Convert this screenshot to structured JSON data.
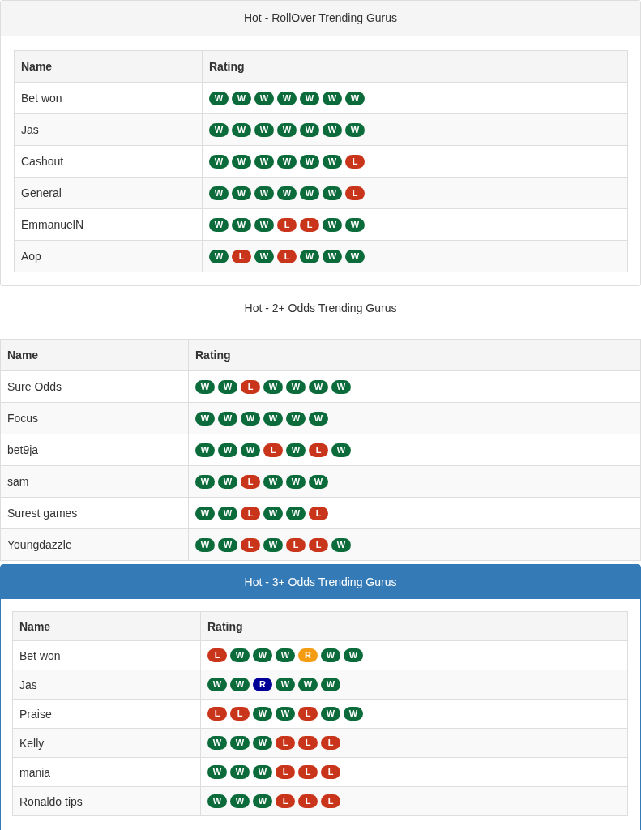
{
  "panels": [
    {
      "kind": "default",
      "title": "Hot - RollOver Trending Gurus",
      "columns": [
        "Name",
        "Rating"
      ],
      "rows": [
        {
          "name": "Bet won",
          "badges": [
            {
              "label": "W",
              "color": "#0b6b3a"
            },
            {
              "label": "W",
              "color": "#0b6b3a"
            },
            {
              "label": "W",
              "color": "#0b6b3a"
            },
            {
              "label": "W",
              "color": "#0b6b3a"
            },
            {
              "label": "W",
              "color": "#0b6b3a"
            },
            {
              "label": "W",
              "color": "#0b6b3a"
            },
            {
              "label": "W",
              "color": "#0b6b3a"
            }
          ]
        },
        {
          "name": "Jas",
          "badges": [
            {
              "label": "W",
              "color": "#0b6b3a"
            },
            {
              "label": "W",
              "color": "#0b6b3a"
            },
            {
              "label": "W",
              "color": "#0b6b3a"
            },
            {
              "label": "W",
              "color": "#0b6b3a"
            },
            {
              "label": "W",
              "color": "#0b6b3a"
            },
            {
              "label": "W",
              "color": "#0b6b3a"
            },
            {
              "label": "W",
              "color": "#0b6b3a"
            }
          ]
        },
        {
          "name": "Cashout",
          "badges": [
            {
              "label": "W",
              "color": "#0b6b3a"
            },
            {
              "label": "W",
              "color": "#0b6b3a"
            },
            {
              "label": "W",
              "color": "#0b6b3a"
            },
            {
              "label": "W",
              "color": "#0b6b3a"
            },
            {
              "label": "W",
              "color": "#0b6b3a"
            },
            {
              "label": "W",
              "color": "#0b6b3a"
            },
            {
              "label": "L",
              "color": "#c9351a"
            }
          ]
        },
        {
          "name": "General",
          "badges": [
            {
              "label": "W",
              "color": "#0b6b3a"
            },
            {
              "label": "W",
              "color": "#0b6b3a"
            },
            {
              "label": "W",
              "color": "#0b6b3a"
            },
            {
              "label": "W",
              "color": "#0b6b3a"
            },
            {
              "label": "W",
              "color": "#0b6b3a"
            },
            {
              "label": "W",
              "color": "#0b6b3a"
            },
            {
              "label": "L",
              "color": "#c9351a"
            }
          ]
        },
        {
          "name": "EmmanuelN",
          "badges": [
            {
              "label": "W",
              "color": "#0b6b3a"
            },
            {
              "label": "W",
              "color": "#0b6b3a"
            },
            {
              "label": "W",
              "color": "#0b6b3a"
            },
            {
              "label": "L",
              "color": "#c9351a"
            },
            {
              "label": "L",
              "color": "#c9351a"
            },
            {
              "label": "W",
              "color": "#0b6b3a"
            },
            {
              "label": "W",
              "color": "#0b6b3a"
            }
          ]
        },
        {
          "name": "Aop",
          "badges": [
            {
              "label": "W",
              "color": "#0b6b3a"
            },
            {
              "label": "L",
              "color": "#c9351a"
            },
            {
              "label": "W",
              "color": "#0b6b3a"
            },
            {
              "label": "L",
              "color": "#c9351a"
            },
            {
              "label": "W",
              "color": "#0b6b3a"
            },
            {
              "label": "W",
              "color": "#0b6b3a"
            },
            {
              "label": "W",
              "color": "#0b6b3a"
            }
          ]
        }
      ]
    },
    {
      "kind": "plain",
      "title": "Hot - 2+ Odds Trending Gurus",
      "columns": [
        "Name",
        "Rating"
      ],
      "rows": [
        {
          "name": "Sure Odds",
          "badges": [
            {
              "label": "W",
              "color": "#0b6b3a"
            },
            {
              "label": "W",
              "color": "#0b6b3a"
            },
            {
              "label": "L",
              "color": "#c9351a"
            },
            {
              "label": "W",
              "color": "#0b6b3a"
            },
            {
              "label": "W",
              "color": "#0b6b3a"
            },
            {
              "label": "W",
              "color": "#0b6b3a"
            },
            {
              "label": "W",
              "color": "#0b6b3a"
            }
          ]
        },
        {
          "name": "Focus",
          "badges": [
            {
              "label": "W",
              "color": "#0b6b3a"
            },
            {
              "label": "W",
              "color": "#0b6b3a"
            },
            {
              "label": "W",
              "color": "#0b6b3a"
            },
            {
              "label": "W",
              "color": "#0b6b3a"
            },
            {
              "label": "W",
              "color": "#0b6b3a"
            },
            {
              "label": "W",
              "color": "#0b6b3a"
            }
          ]
        },
        {
          "name": "bet9ja",
          "badges": [
            {
              "label": "W",
              "color": "#0b6b3a"
            },
            {
              "label": "W",
              "color": "#0b6b3a"
            },
            {
              "label": "W",
              "color": "#0b6b3a"
            },
            {
              "label": "L",
              "color": "#c9351a"
            },
            {
              "label": "W",
              "color": "#0b6b3a"
            },
            {
              "label": "L",
              "color": "#c9351a"
            },
            {
              "label": "W",
              "color": "#0b6b3a"
            }
          ]
        },
        {
          "name": "sam",
          "badges": [
            {
              "label": "W",
              "color": "#0b6b3a"
            },
            {
              "label": "W",
              "color": "#0b6b3a"
            },
            {
              "label": "L",
              "color": "#c9351a"
            },
            {
              "label": "W",
              "color": "#0b6b3a"
            },
            {
              "label": "W",
              "color": "#0b6b3a"
            },
            {
              "label": "W",
              "color": "#0b6b3a"
            }
          ]
        },
        {
          "name": "Surest games",
          "badges": [
            {
              "label": "W",
              "color": "#0b6b3a"
            },
            {
              "label": "W",
              "color": "#0b6b3a"
            },
            {
              "label": "L",
              "color": "#c9351a"
            },
            {
              "label": "W",
              "color": "#0b6b3a"
            },
            {
              "label": "W",
              "color": "#0b6b3a"
            },
            {
              "label": "L",
              "color": "#c9351a"
            }
          ]
        },
        {
          "name": "Youngdazzle",
          "badges": [
            {
              "label": "W",
              "color": "#0b6b3a"
            },
            {
              "label": "W",
              "color": "#0b6b3a"
            },
            {
              "label": "L",
              "color": "#c9351a"
            },
            {
              "label": "W",
              "color": "#0b6b3a"
            },
            {
              "label": "L",
              "color": "#c9351a"
            },
            {
              "label": "L",
              "color": "#c9351a"
            },
            {
              "label": "W",
              "color": "#0b6b3a"
            }
          ]
        }
      ]
    },
    {
      "kind": "primary",
      "title": "Hot - 3+ Odds Trending Gurus",
      "columns": [
        "Name",
        "Rating"
      ],
      "rows": [
        {
          "name": "Bet won",
          "badges": [
            {
              "label": "L",
              "color": "#c9351a"
            },
            {
              "label": "W",
              "color": "#0b6b3a"
            },
            {
              "label": "W",
              "color": "#0b6b3a"
            },
            {
              "label": "W",
              "color": "#0b6b3a"
            },
            {
              "label": "R",
              "color": "#f39c12"
            },
            {
              "label": "W",
              "color": "#0b6b3a"
            },
            {
              "label": "W",
              "color": "#0b6b3a"
            }
          ]
        },
        {
          "name": "Jas",
          "badges": [
            {
              "label": "W",
              "color": "#0b6b3a"
            },
            {
              "label": "W",
              "color": "#0b6b3a"
            },
            {
              "label": "R",
              "color": "#000099"
            },
            {
              "label": "W",
              "color": "#0b6b3a"
            },
            {
              "label": "W",
              "color": "#0b6b3a"
            },
            {
              "label": "W",
              "color": "#0b6b3a"
            }
          ]
        },
        {
          "name": "Praise",
          "badges": [
            {
              "label": "L",
              "color": "#c9351a"
            },
            {
              "label": "L",
              "color": "#c9351a"
            },
            {
              "label": "W",
              "color": "#0b6b3a"
            },
            {
              "label": "W",
              "color": "#0b6b3a"
            },
            {
              "label": "L",
              "color": "#c9351a"
            },
            {
              "label": "W",
              "color": "#0b6b3a"
            },
            {
              "label": "W",
              "color": "#0b6b3a"
            }
          ]
        },
        {
          "name": "Kelly",
          "badges": [
            {
              "label": "W",
              "color": "#0b6b3a"
            },
            {
              "label": "W",
              "color": "#0b6b3a"
            },
            {
              "label": "W",
              "color": "#0b6b3a"
            },
            {
              "label": "L",
              "color": "#c9351a"
            },
            {
              "label": "L",
              "color": "#c9351a"
            },
            {
              "label": "L",
              "color": "#c9351a"
            }
          ]
        },
        {
          "name": "mania",
          "badges": [
            {
              "label": "W",
              "color": "#0b6b3a"
            },
            {
              "label": "W",
              "color": "#0b6b3a"
            },
            {
              "label": "W",
              "color": "#0b6b3a"
            },
            {
              "label": "L",
              "color": "#c9351a"
            },
            {
              "label": "L",
              "color": "#c9351a"
            },
            {
              "label": "L",
              "color": "#c9351a"
            }
          ]
        },
        {
          "name": "Ronaldo tips",
          "badges": [
            {
              "label": "W",
              "color": "#0b6b3a"
            },
            {
              "label": "W",
              "color": "#0b6b3a"
            },
            {
              "label": "W",
              "color": "#0b6b3a"
            },
            {
              "label": "L",
              "color": "#c9351a"
            },
            {
              "label": "L",
              "color": "#c9351a"
            },
            {
              "label": "L",
              "color": "#c9351a"
            }
          ]
        }
      ]
    }
  ]
}
